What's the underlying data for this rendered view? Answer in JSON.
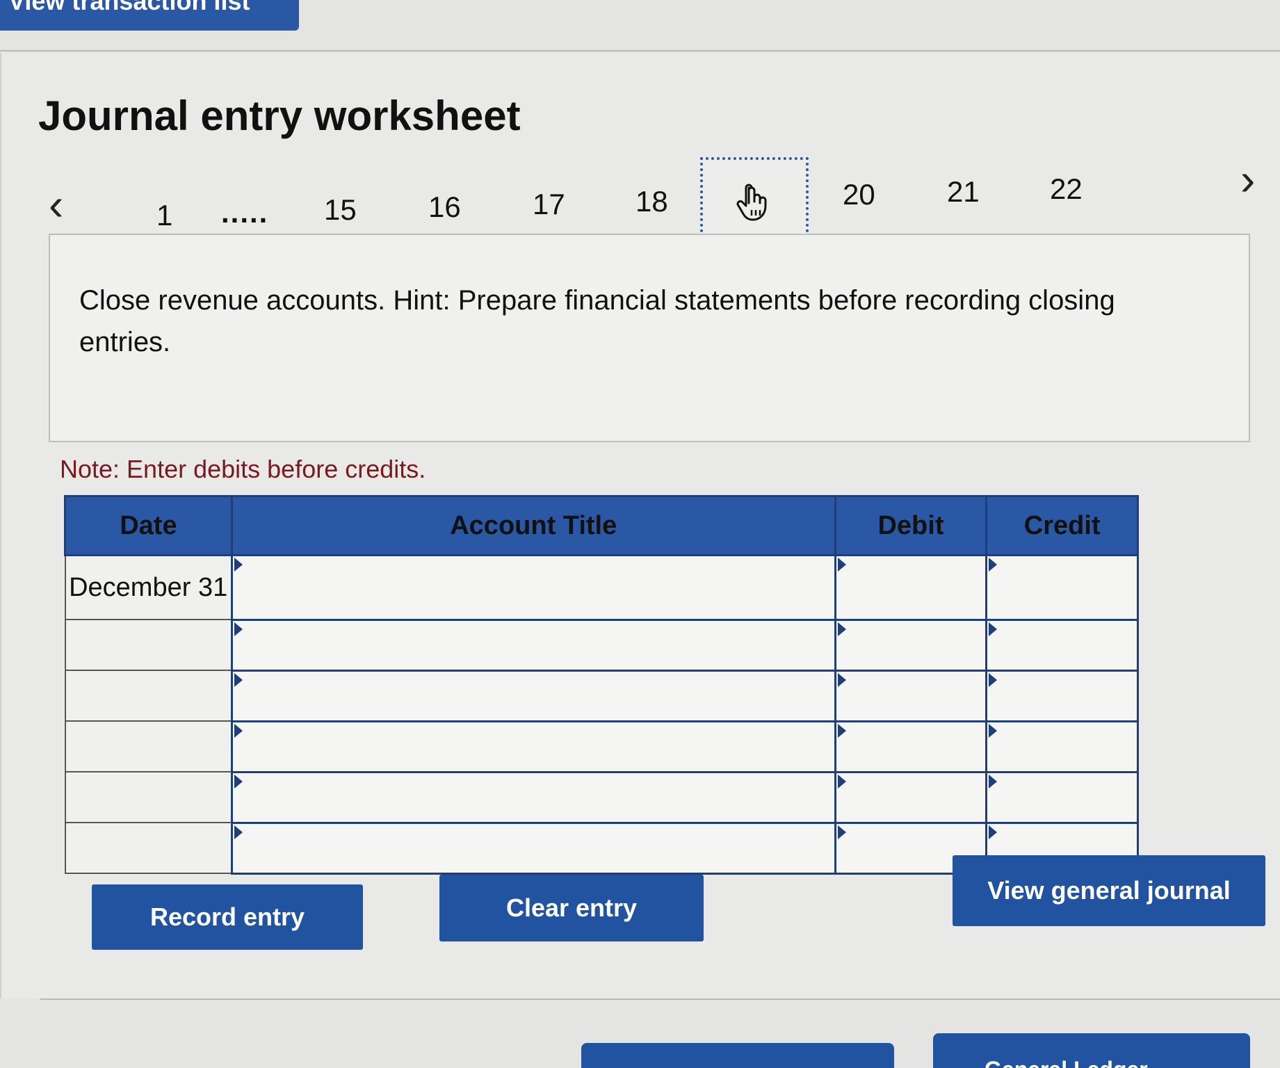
{
  "top_tab": {
    "label": "View transaction list"
  },
  "worksheet": {
    "title": "Journal entry worksheet",
    "pagination": {
      "prev_icon": "‹",
      "next_icon": "›",
      "pages": [
        "1",
        ".....",
        "15",
        "16",
        "17",
        "18",
        "20",
        "21",
        "22"
      ],
      "current_icon": "hand-pointer-icon"
    },
    "instruction": "Close revenue accounts. Hint: Prepare financial statements before recording closing entries.",
    "note": "Note: Enter debits before credits."
  },
  "table": {
    "headers": {
      "date": "Date",
      "account": "Account Title",
      "debit": "Debit",
      "credit": "Credit"
    },
    "rows": [
      {
        "date": "December 31"
      },
      {
        "date": ""
      },
      {
        "date": ""
      },
      {
        "date": ""
      },
      {
        "date": ""
      },
      {
        "date": ""
      }
    ]
  },
  "buttons": {
    "record": "Record entry",
    "clear": "Clear entry",
    "view_journal": "View general journal",
    "general_ledger": "General Ledger"
  },
  "colors": {
    "accent": "#2253a0",
    "note": "#7a1a1f"
  }
}
